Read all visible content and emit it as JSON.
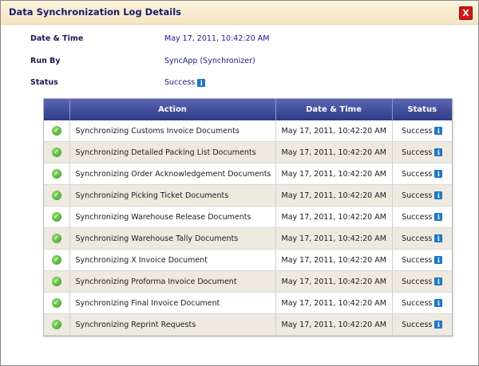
{
  "dialog": {
    "title": "Data Synchronization Log Details",
    "close_label": "X"
  },
  "info": {
    "datetime_label": "Date & Time",
    "datetime_value": "May 17, 2011, 10:42:20 AM",
    "runby_label": "Run By",
    "runby_value": "SyncApp (Synchronizer)",
    "status_label": "Status",
    "status_value": "Success",
    "info_glyph": "i"
  },
  "table": {
    "headers": [
      "",
      "Action",
      "Date & Time",
      "Status"
    ],
    "rows": [
      {
        "action": "Synchronizing Customs Invoice Documents",
        "datetime": "May 17, 2011, 10:42:20 AM",
        "status": "Success"
      },
      {
        "action": "Synchronizing Detailed Packing List Documents",
        "datetime": "May 17, 2011, 10:42:20 AM",
        "status": "Success"
      },
      {
        "action": "Synchronizing Order Acknowledgement Documents",
        "datetime": "May 17, 2011, 10:42:20 AM",
        "status": "Success"
      },
      {
        "action": "Synchronizing Picking Ticket Documents",
        "datetime": "May 17, 2011, 10:42:20 AM",
        "status": "Success"
      },
      {
        "action": "Synchronizing Warehouse Release Documents",
        "datetime": "May 17, 2011, 10:42:20 AM",
        "status": "Success"
      },
      {
        "action": "Synchronizing Warehouse Tally Documents",
        "datetime": "May 17, 2011, 10:42:20 AM",
        "status": "Success"
      },
      {
        "action": "Synchronizing X Invoice Document",
        "datetime": "May 17, 2011, 10:42:20 AM",
        "status": "Success"
      },
      {
        "action": "Synchronizing Proforma Invoice Document",
        "datetime": "May 17, 2011, 10:42:20 AM",
        "status": "Success"
      },
      {
        "action": "Synchronizing Final Invoice Document",
        "datetime": "May 17, 2011, 10:42:20 AM",
        "status": "Success"
      },
      {
        "action": "Synchronizing Reprint Requests",
        "datetime": "May 17, 2011, 10:42:20 AM",
        "status": "Success"
      }
    ]
  },
  "icons": {
    "success": "check-circle-icon",
    "info": "info-icon",
    "close": "close-icon"
  },
  "colors": {
    "header_bg": "#3a4592",
    "alt_row_bg": "#eeeae0",
    "close_bg": "#d01818",
    "success_green": "#3a9a22",
    "info_blue": "#1e78c8"
  }
}
